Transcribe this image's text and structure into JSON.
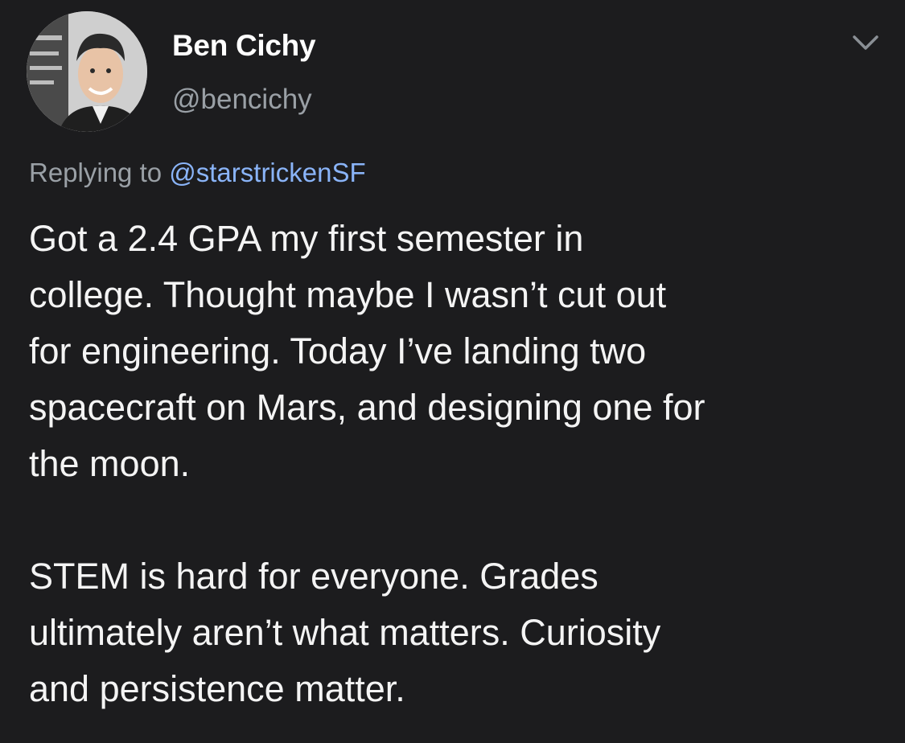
{
  "tweet": {
    "display_name": "Ben Cichy",
    "handle": "@bencichy",
    "reply_prefix": "Replying to ",
    "reply_mention": "@starstrickenSF",
    "paragraph1_lines": [
      "Got a 2.4 GPA my first semester in",
      "college. Thought maybe I wasn’t cut out",
      "for engineering. Today I’ve landing two",
      "spacecraft on Mars, and designing one for",
      "the moon."
    ],
    "paragraph2_lines": [
      "STEM is hard for everyone. Grades",
      "ultimately aren’t what matters.  Curiosity",
      "and persistence matter."
    ]
  },
  "icons": {
    "menu": "chevron-down-icon",
    "avatar": "profile-photo"
  },
  "colors": {
    "background": "#1c1c1e",
    "text": "#f4f4f4",
    "secondary": "#9aa0a6",
    "mention": "#8ab4f8"
  }
}
